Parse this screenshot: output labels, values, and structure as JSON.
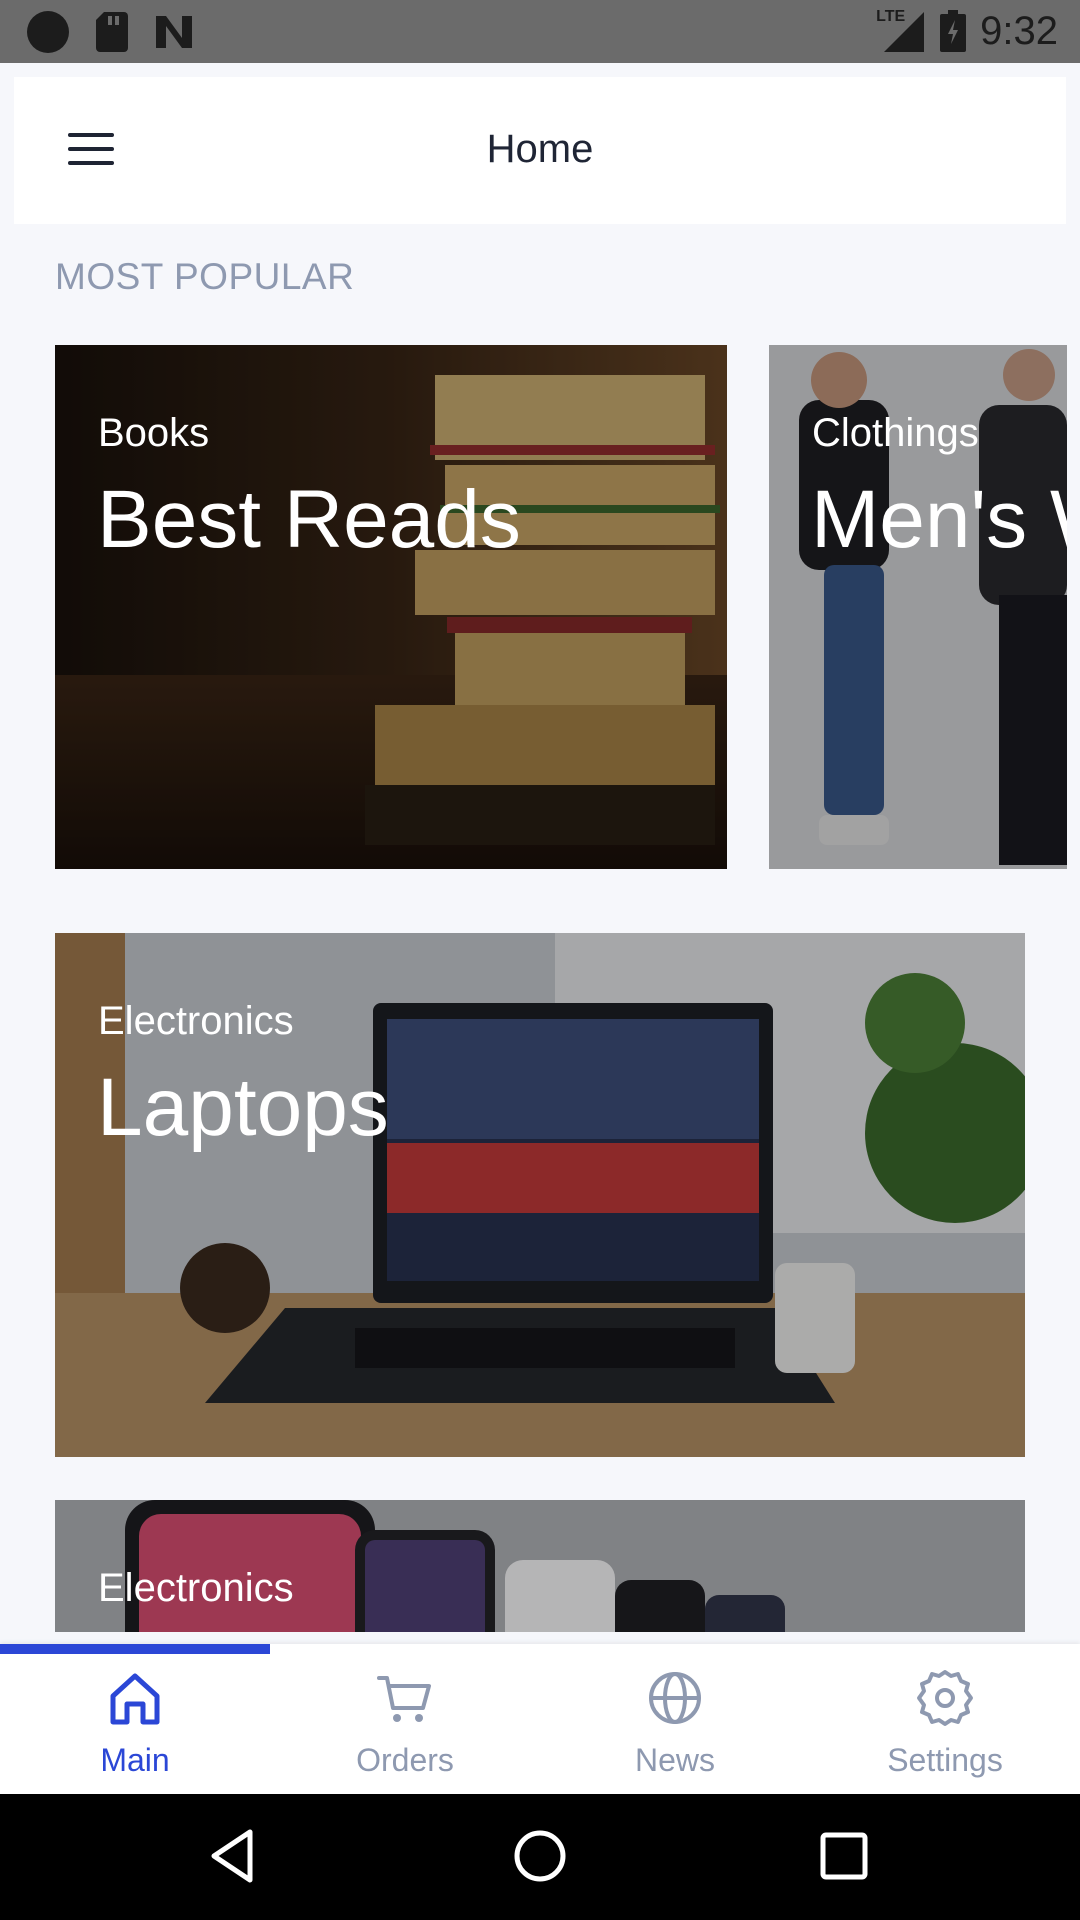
{
  "status_bar": {
    "time": "9:32",
    "network": "LTE"
  },
  "app_bar": {
    "title": "Home"
  },
  "section": {
    "title": "MOST POPULAR"
  },
  "cards": [
    {
      "category": "Books",
      "headline": "Best Reads"
    },
    {
      "category": "Clothings",
      "headline": "Men's Wear"
    },
    {
      "category": "Electronics",
      "headline": "Laptops"
    },
    {
      "category": "Electronics",
      "headline": ""
    }
  ],
  "bottom_nav": {
    "active_index": 0,
    "items": [
      {
        "label": "Main",
        "icon": "home-icon"
      },
      {
        "label": "Orders",
        "icon": "cart-icon"
      },
      {
        "label": "News",
        "icon": "globe-icon"
      },
      {
        "label": "Settings",
        "icon": "gear-icon"
      }
    ]
  },
  "colors": {
    "accent": "#2b47d6",
    "inactive": "#8e99b0",
    "background": "#f6f7fb"
  }
}
